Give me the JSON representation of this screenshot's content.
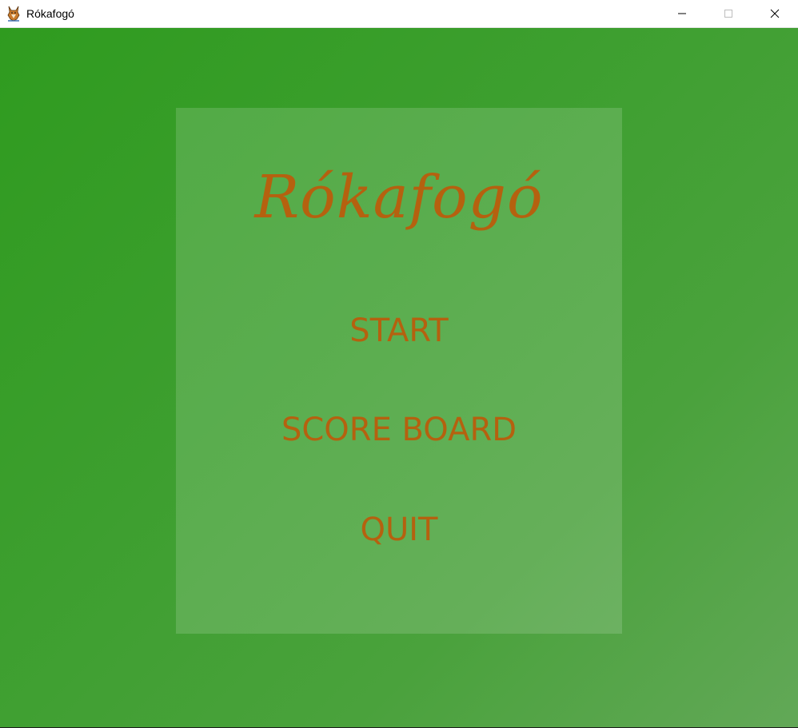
{
  "window": {
    "title": "Rókafogó",
    "icon": "fox-icon",
    "controls": [
      "minimize-icon",
      "maximize-icon",
      "close-icon"
    ]
  },
  "menu": {
    "game_title": "Rókafogó",
    "start_label": "START",
    "scoreboard_label": "SCORE BOARD",
    "quit_label": "QUIT"
  },
  "colors": {
    "background_top_left": "#2f9b1f",
    "background_bottom_right": "#62a857",
    "text_accent": "#b5610f",
    "panel_overlay": "rgba(255,255,255,0.15)"
  }
}
